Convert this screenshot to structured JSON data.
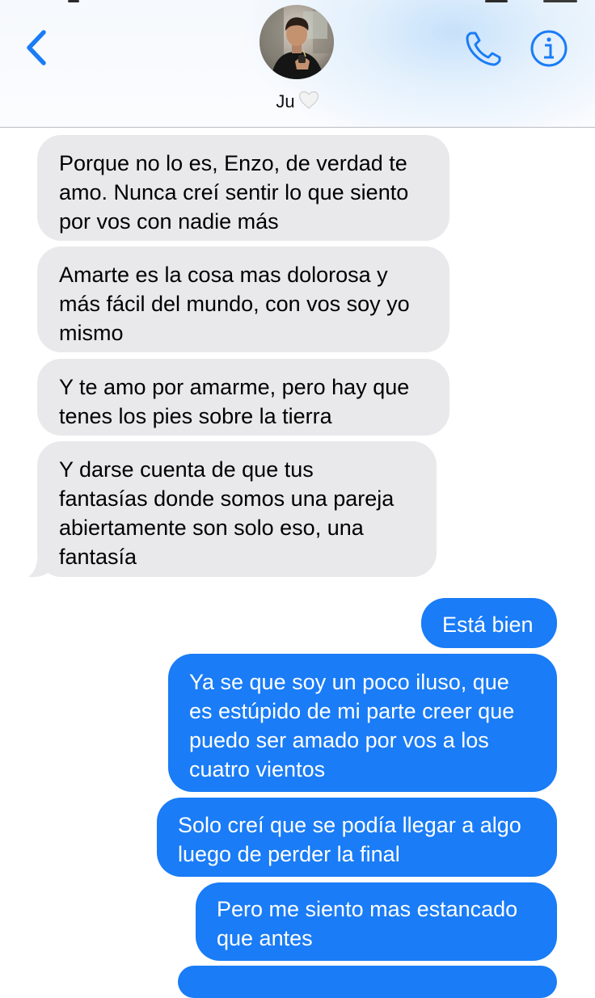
{
  "header": {
    "back_icon": "chevron-left-icon",
    "phone_icon": "phone-icon",
    "info_icon": "info-icon",
    "avatar": "avatar-photo",
    "contact_name": "Ju",
    "contact_emoji": "white-heart-icon",
    "accent_color": "#1a7cf6"
  },
  "messages": {
    "incoming": [
      {
        "text": "Porque no lo es, Enzo, de verdad te\namo. Nunca creí sentir lo que siento\npor vos con nadie más"
      },
      {
        "text": "Amarte es la cosa mas dolorosa y\nmás fácil del mundo, con vos soy yo\nmismo"
      },
      {
        "text": "Y te amo por amarme, pero hay que\ntenes los pies sobre la tierra"
      },
      {
        "text": "Y darse cuenta de que tus\nfantasías donde somos una pareja\nabiertamente son solo eso, una\nfantasía"
      }
    ],
    "outgoing": [
      {
        "text": "Está bien"
      },
      {
        "text": "Ya se que soy un poco iluso, que\nes estúpido de mi parte creer que\npuedo ser amado por vos a los\ncuatro vientos"
      },
      {
        "text": "Solo creí que se podía llegar a algo\nluego de perder la final"
      },
      {
        "text": "Pero me siento mas estancado\nque antes"
      }
    ],
    "incoming_bubble_color": "#e9e9eb",
    "outgoing_bubble_color": "#1a7cf6"
  }
}
